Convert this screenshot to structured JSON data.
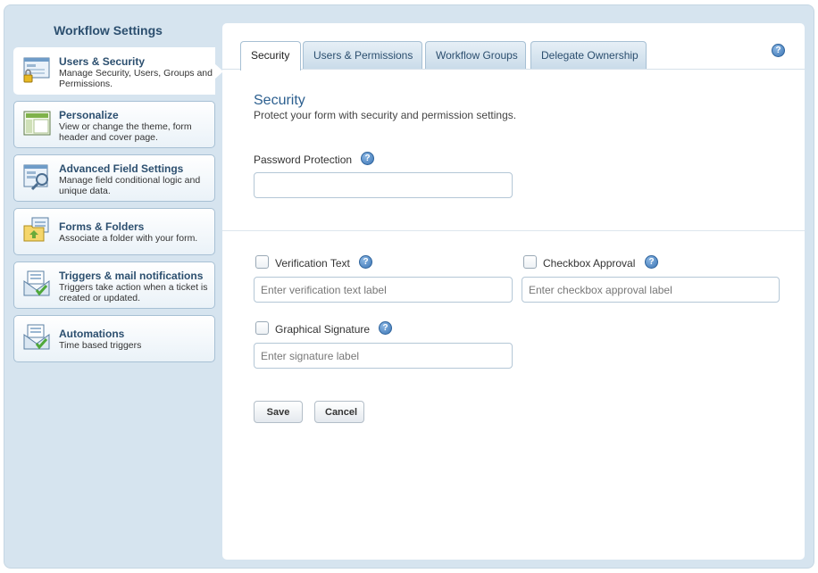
{
  "sidebar": {
    "title": "Workflow Settings",
    "items": [
      {
        "title": "Users & Security",
        "desc": "Manage Security, Users, Groups and Permissions.",
        "icon": "users-security-icon"
      },
      {
        "title": "Personalize",
        "desc": "View or change the theme, form header and cover page.",
        "icon": "personalize-icon"
      },
      {
        "title": "Advanced Field Settings",
        "desc": "Manage field conditional logic and unique data.",
        "icon": "advanced-field-icon"
      },
      {
        "title": "Forms & Folders",
        "desc": "Associate a folder with your form.",
        "icon": "folder-icon"
      },
      {
        "title": "Triggers & mail notifications",
        "desc": "Triggers take action when a ticket is created or updated.",
        "icon": "mail-trigger-icon"
      },
      {
        "title": "Automations",
        "desc": "Time based triggers",
        "icon": "automation-icon"
      }
    ]
  },
  "tabs": [
    {
      "label": "Security"
    },
    {
      "label": "Users & Permissions"
    },
    {
      "label": "Workflow Groups"
    },
    {
      "label": "Delegate Ownership"
    }
  ],
  "help_glyph": "?",
  "security": {
    "title": "Security",
    "subtitle": "Protect your form with security and permission settings.",
    "password_label": "Password Protection",
    "password_value": "",
    "verification_label": "Verification Text",
    "verification_placeholder": "Enter verification text label",
    "checkbox_approval_label": "Checkbox Approval",
    "checkbox_approval_placeholder": "Enter checkbox approval label",
    "signature_label": "Graphical Signature",
    "signature_placeholder": "Enter signature label"
  },
  "buttons": {
    "save": "Save",
    "cancel": "Cancel"
  },
  "colors": {
    "accent": "#2c5f8f",
    "frame": "#d6e4ef"
  }
}
